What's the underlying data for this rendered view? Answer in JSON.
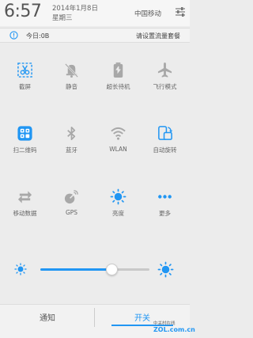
{
  "status_bar": {
    "time": "6:57",
    "date_line1": "2014年1月8日",
    "date_line2": "星期三",
    "carrier": "中国移动"
  },
  "traffic": {
    "today": "今日:0B",
    "set_plan": "请设置流量套餐"
  },
  "toggles": [
    {
      "label": "截屏",
      "icon": "screenshot-icon",
      "state": "on"
    },
    {
      "label": "静音",
      "icon": "mute-icon",
      "state": "off"
    },
    {
      "label": "超长待机",
      "icon": "battery-saver-icon",
      "state": "off"
    },
    {
      "label": "飞行模式",
      "icon": "airplane-icon",
      "state": "off"
    },
    {
      "label": "扫二维码",
      "icon": "qr-scan-icon",
      "state": "on"
    },
    {
      "label": "蓝牙",
      "icon": "bluetooth-icon",
      "state": "off"
    },
    {
      "label": "WLAN",
      "icon": "wifi-icon",
      "state": "off"
    },
    {
      "label": "自动旋转",
      "icon": "auto-rotate-icon",
      "state": "on"
    },
    {
      "label": "移动数据",
      "icon": "mobile-data-icon",
      "state": "off"
    },
    {
      "label": "GPS",
      "icon": "gps-icon",
      "state": "off"
    },
    {
      "label": "亮度",
      "icon": "brightness-icon",
      "state": "on"
    },
    {
      "label": "更多",
      "icon": "more-icon",
      "state": "on"
    }
  ],
  "brightness": {
    "level": 0.65
  },
  "tabs": {
    "notifications": "通知",
    "switches": "开关",
    "active": "switches"
  },
  "watermark": {
    "top": "中关村在线",
    "bottom": "ZOL.com.cn"
  },
  "colors": {
    "accent": "#2196f3",
    "inactive_icon": "#a8a8a8",
    "background": "#ececec"
  }
}
